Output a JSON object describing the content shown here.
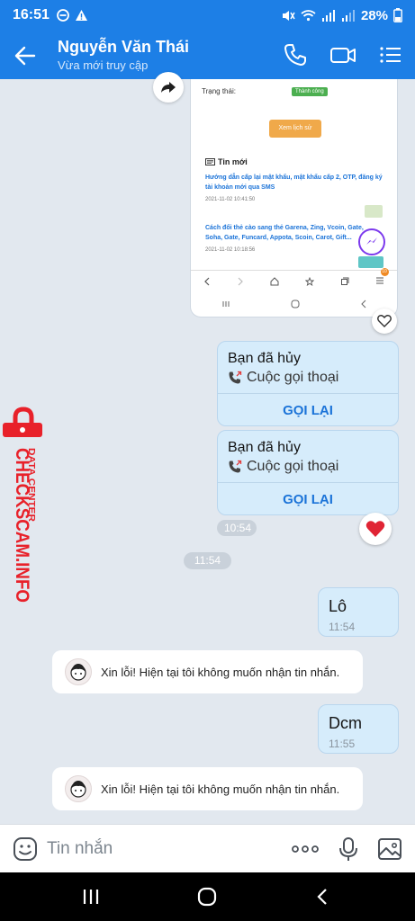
{
  "status": {
    "time": "16:51",
    "battery": "28%"
  },
  "header": {
    "contact_name": "Nguyễn Văn Thái",
    "presence": "Vừa mới truy cập"
  },
  "screenshot": {
    "status_label": "Trạng thái:",
    "status_badge": "Thành công",
    "history_button": "Xem lịch sử",
    "news_heading": "Tin mới",
    "news": [
      {
        "title": "Hướng dẫn cấp lại mật khẩu, mật khẩu cấp 2, OTP, đăng ký tài khoản mới qua SMS",
        "date": "2021-11-02 10:41:50"
      },
      {
        "title": "Cách đổi thẻ cào sang thẻ Garena, Zing, Vcoin, Gate, Soha, Gate, Funcard, Appota, Scoin, Carot, Gift...",
        "date": "2021-11-02 10:18:56"
      }
    ],
    "badge_count": "10"
  },
  "calls": [
    {
      "title": "Bạn đã hủy",
      "subtitle": "Cuộc gọi thoại",
      "action": "GỌI LẠI"
    },
    {
      "title": "Bạn đã hủy",
      "subtitle": "Cuộc gọi thoại",
      "action": "GỌI LẠI"
    }
  ],
  "timestamps": {
    "calls_time": "10:54",
    "divider_time": "11:54"
  },
  "messages": [
    {
      "text": "Lô",
      "time": "11:54"
    },
    {
      "text": "Dcm",
      "time": "11:55"
    }
  ],
  "auto_replies": [
    {
      "text": "Xin lỗi! Hiện tại tôi không muốn nhận tin nhắn."
    },
    {
      "text": "Xin lỗi! Hiện tại tôi không muốn nhận tin nhắn."
    }
  ],
  "watermark": {
    "line1": "DATA CENTER",
    "line2": "CHECKSCAM.INFO"
  },
  "composer": {
    "placeholder": "Tin nhắn"
  },
  "icons": {
    "back": "back-arrow-icon",
    "call": "phone-icon",
    "video": "video-camera-icon",
    "menu": "list-menu-icon",
    "emoji": "emoji-icon",
    "more": "more-dots-icon",
    "mic": "microphone-icon",
    "gallery": "image-icon"
  },
  "colors": {
    "brand_blue": "#1d7fe6",
    "bubble_blue": "#d6ecfb",
    "link_blue": "#1b73d8",
    "heart_red": "#e02434",
    "watermark_red": "#e8212a"
  }
}
